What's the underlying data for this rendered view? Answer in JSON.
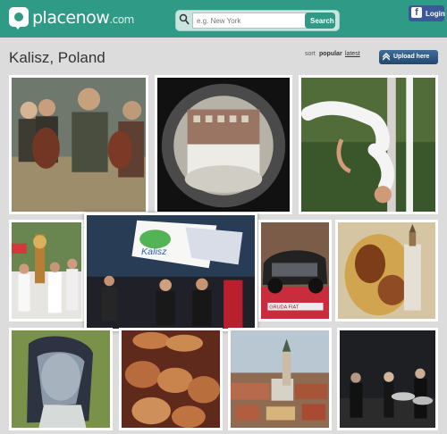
{
  "header": {
    "brand": "placenow",
    "brand_suffix": ".com",
    "search_placeholder": "e.g. New York",
    "search_button": "Search",
    "facebook_login": "Login"
  },
  "page": {
    "city": "Kalisz, Poland",
    "sort_label": "sort",
    "sort_popular": "popular",
    "sort_latest": "latest",
    "upload_button": "Upload here"
  },
  "photos": [
    {
      "subject": "medieval-warriors"
    },
    {
      "subject": "fisheye-square"
    },
    {
      "subject": "aerial-acrobat"
    },
    {
      "subject": "historic-parade"
    },
    {
      "subject": "flag-parade"
    },
    {
      "subject": "sports-car"
    },
    {
      "subject": "easter-egg"
    },
    {
      "subject": "blue-statue"
    },
    {
      "subject": "coins"
    },
    {
      "subject": "city-view"
    },
    {
      "subject": "concert"
    }
  ],
  "overlay_texts": {
    "flag_text": "Kalisz",
    "banner_text": "GRUDA FIAT"
  },
  "colors": {
    "header_bg": "#2f9a86",
    "background": "#dcdcdc",
    "upload_bg": "#24476f",
    "facebook": "#3b5998"
  }
}
